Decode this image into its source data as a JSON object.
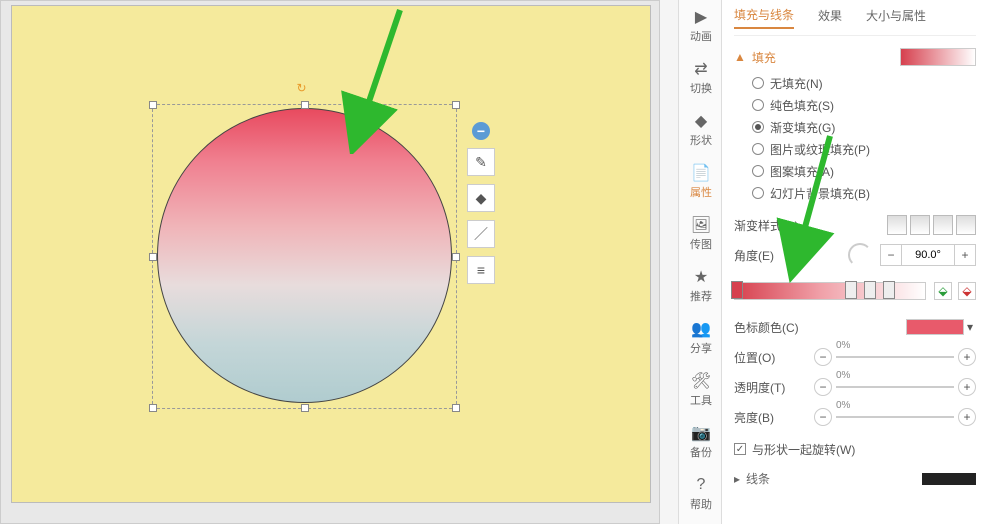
{
  "vtoolbar": [
    {
      "icon": "▶",
      "label": "动画"
    },
    {
      "icon": "⇄",
      "label": "切换"
    },
    {
      "icon": "◆",
      "label": "形状"
    },
    {
      "icon": "📄",
      "label": "属性",
      "active": true
    },
    {
      "icon": "🖼",
      "label": "传图"
    },
    {
      "icon": "★",
      "label": "推荐"
    },
    {
      "icon": "👥",
      "label": "分享"
    },
    {
      "icon": "🛠",
      "label": "工具"
    },
    {
      "icon": "📷",
      "label": "备份"
    },
    {
      "icon": "?",
      "label": "帮助"
    }
  ],
  "tabs": [
    "填充与线条",
    "效果",
    "大小与属性"
  ],
  "active_tab": 0,
  "fill_section": "填充",
  "fill_options": [
    {
      "label": "无填充(N)",
      "on": false
    },
    {
      "label": "纯色填充(S)",
      "on": false
    },
    {
      "label": "渐变填充(G)",
      "on": true
    },
    {
      "label": "图片或纹理填充(P)",
      "on": false
    },
    {
      "label": "图案填充(A)",
      "on": false
    },
    {
      "label": "幻灯片背景填充(B)",
      "on": false
    }
  ],
  "labels": {
    "style": "渐变样式(R)",
    "angle": "角度(E)",
    "stop_color": "色标颜色(C)",
    "position": "位置(O)",
    "transparency": "透明度(T)",
    "brightness": "亮度(B)",
    "rotate_with": "与形状一起旋转(W)",
    "line": "线条"
  },
  "angle_value": "90.0°",
  "pct_zero": "0%",
  "chart_data": null
}
